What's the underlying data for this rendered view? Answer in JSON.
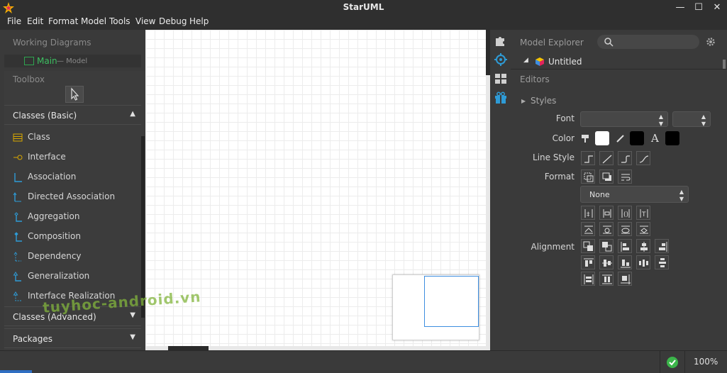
{
  "window": {
    "title": "StarUML"
  },
  "menu": [
    "File",
    "Edit",
    "Format",
    "Model",
    "Tools",
    "View",
    "Debug",
    "Help"
  ],
  "left": {
    "working_diagrams_title": "Working Diagrams",
    "diagram_item": {
      "name": "Main",
      "sub": "— Model"
    },
    "toolbox_title": "Toolbox",
    "group_basic": "Classes (Basic)",
    "tools": [
      "Class",
      "Interface",
      "Association",
      "Directed Association",
      "Aggregation",
      "Composition",
      "Dependency",
      "Generalization",
      "Interface Realization"
    ],
    "group_advanced": "Classes (Advanced)",
    "group_packages": "Packages"
  },
  "right": {
    "model_explorer_title": "Model Explorer",
    "model_root": "Untitled",
    "editors_title": "Editors",
    "styles_label": "Styles",
    "font_label": "Font",
    "color_label": "Color",
    "line_style_label": "Line Style",
    "format_label": "Format",
    "format_value": "None",
    "alignment_label": "Alignment",
    "colors": {
      "fill": "#ffffff",
      "line": "#000000",
      "font": "#000000"
    }
  },
  "status": {
    "zoom": "100%"
  },
  "watermark": "tuyhoc-android.vn"
}
